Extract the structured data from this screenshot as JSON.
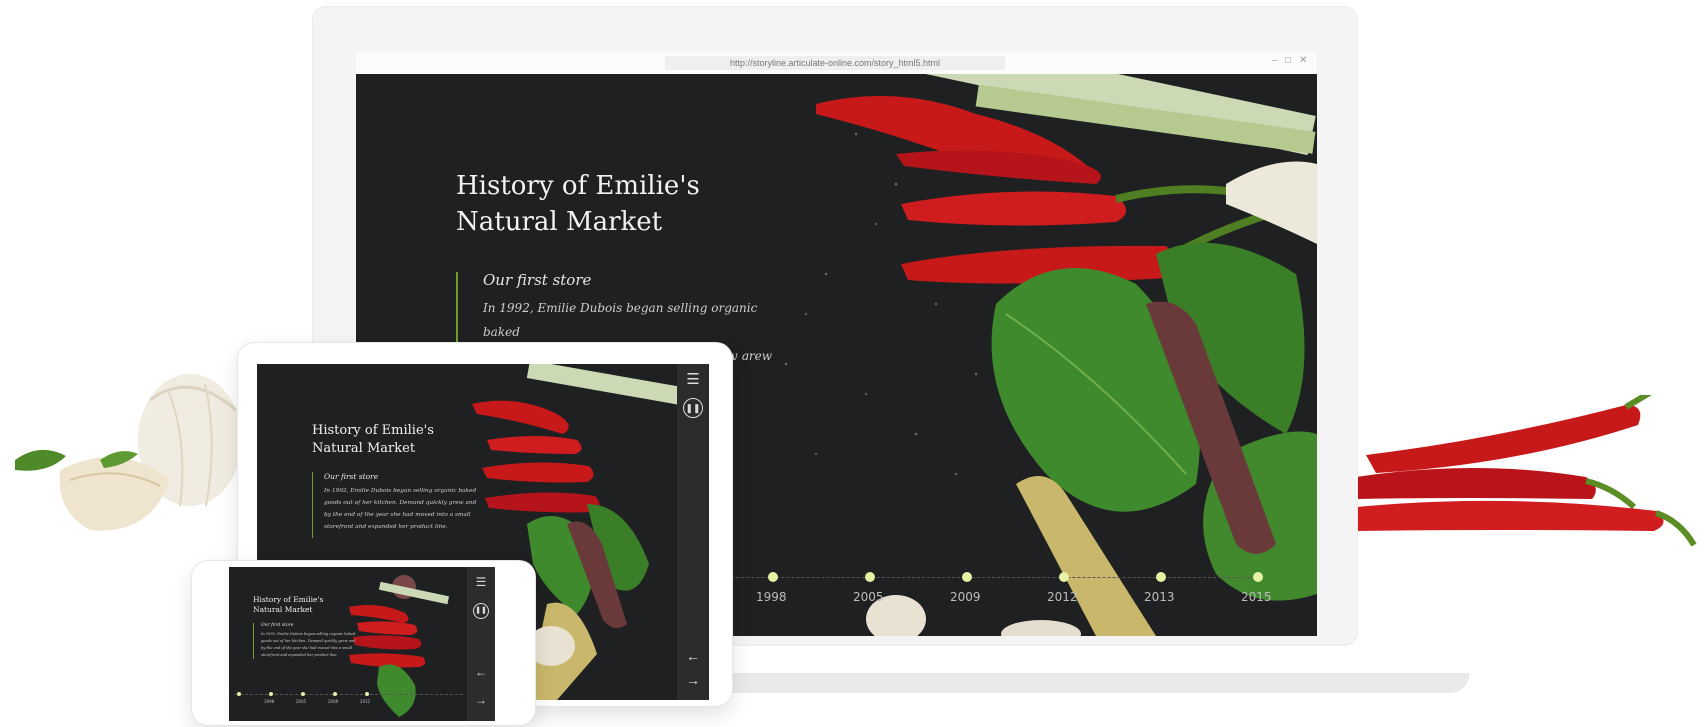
{
  "browser": {
    "url": "http://storyline.articulate-online.com/story_html5.html",
    "controls": [
      "–",
      "□",
      "✕"
    ]
  },
  "story": {
    "title_line1": "History of Emilie's",
    "title_line2": "Natural Market",
    "section_title": "Our first store",
    "body_lines": [
      "In 1992, Emilie Dubois began selling organic baked",
      "goods out of her kitchen. Demand quickly grew and",
      "by the end of the year she had moved into a small",
      "storefront and expanded her product line."
    ],
    "timeline_years": [
      "1998",
      "2005",
      "2009",
      "2012",
      "2013",
      "2015"
    ]
  },
  "controls": {
    "menu_icon": "hamburger-icon",
    "pause_icon": "pause-icon",
    "prev_icon": "arrow-left-icon",
    "next_icon": "arrow-right-icon"
  },
  "colors": {
    "background": "#1f2021",
    "accent": "#7a9b2a",
    "timeline_dot": "#e7f2a4",
    "chili": "#c8191a"
  }
}
